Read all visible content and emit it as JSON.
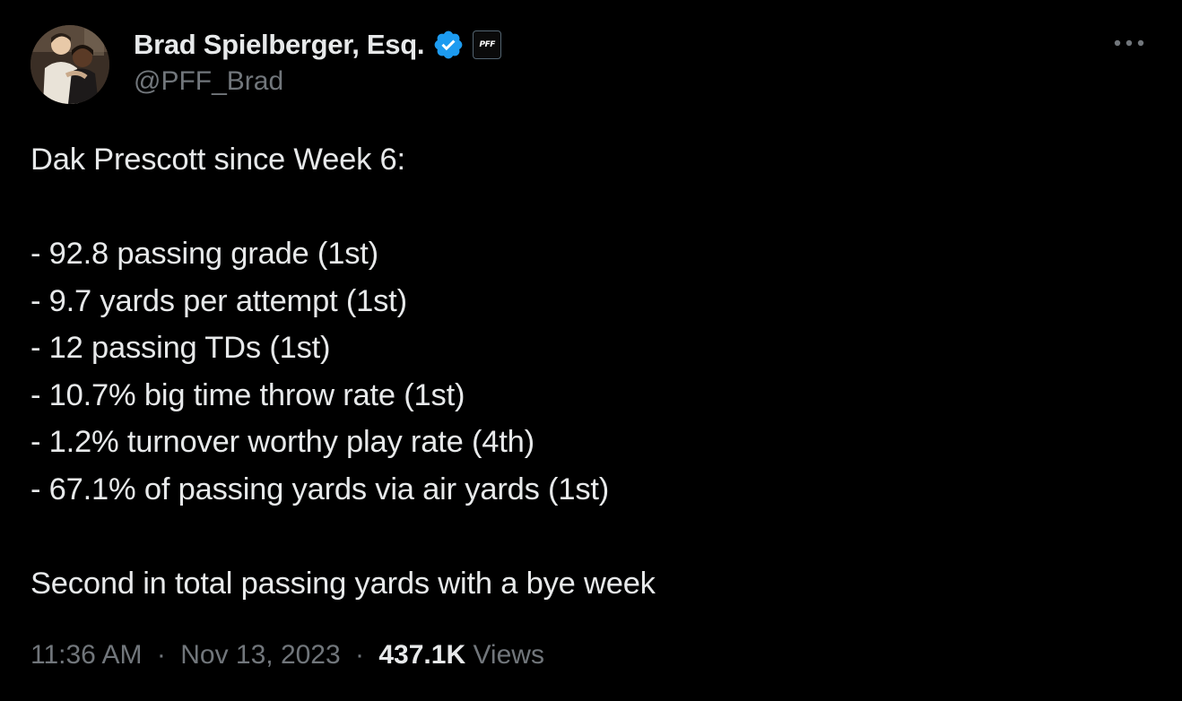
{
  "author": {
    "display_name": "Brad Spielberger, Esq.",
    "handle": "@PFF_Brad",
    "affiliate_badge_text": "PFF"
  },
  "tweet": {
    "lines": [
      "Dak Prescott since Week 6:",
      "",
      "- 92.8 passing grade (1st)",
      "- 9.7 yards per attempt (1st)",
      "- 12 passing TDs (1st)",
      "- 10.7% big time throw rate (1st)",
      "- 1.2% turnover worthy play rate (4th)",
      "- 67.1% of passing yards via air yards (1st)",
      "",
      "Second in total passing yards with a bye week"
    ]
  },
  "meta": {
    "time": "11:36 AM",
    "separator": "·",
    "date": "Nov 13, 2023",
    "views_count": "437.1K",
    "views_label": "Views"
  },
  "icons": {
    "verified": "verified-badge-icon",
    "more": "more-options-icon"
  },
  "colors": {
    "background": "#000000",
    "text_primary": "#e7e9ea",
    "text_secondary": "#71767b",
    "verified_blue": "#1d9bf0"
  }
}
